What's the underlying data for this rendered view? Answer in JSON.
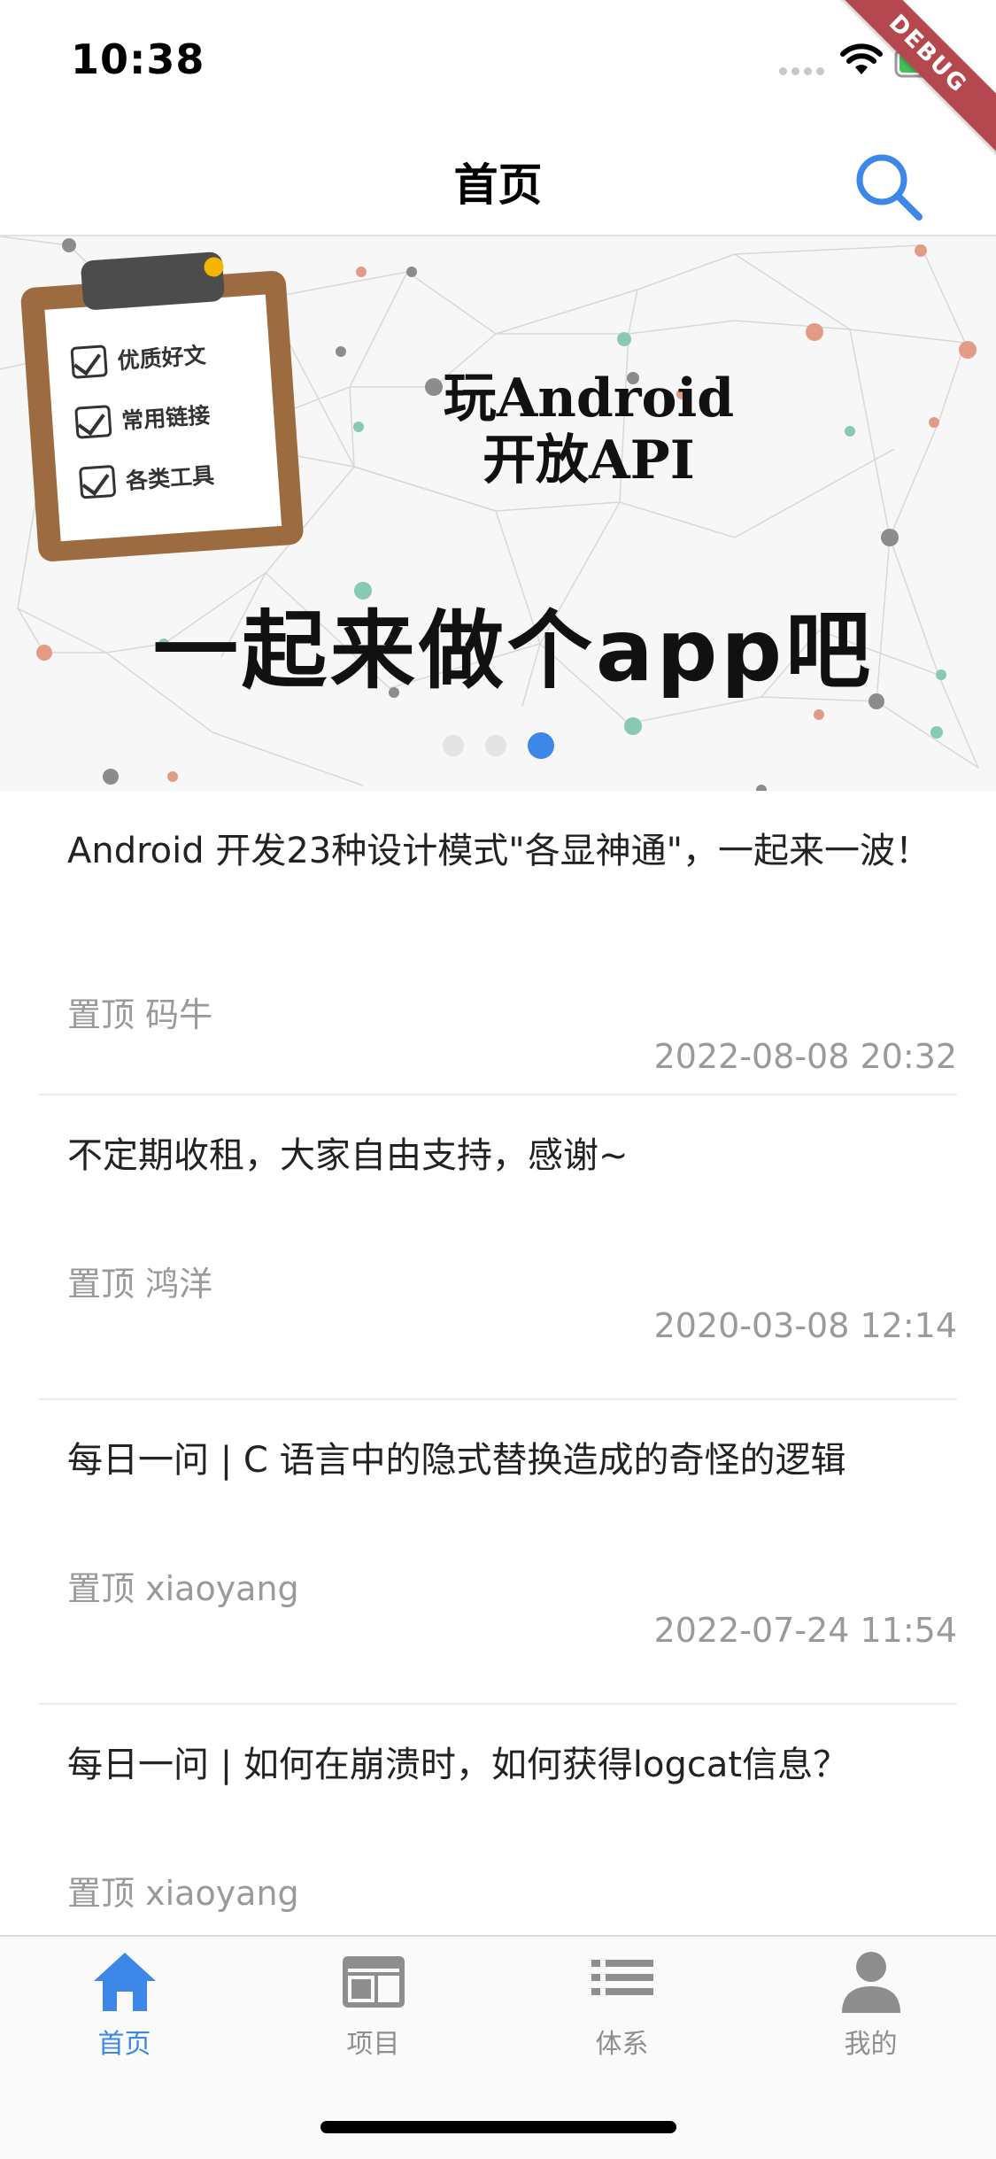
{
  "status_bar": {
    "time": "10:38",
    "debug_label": "DEBUG"
  },
  "app_bar": {
    "title": "首页",
    "search_icon": "search-icon"
  },
  "banner": {
    "clipboard_items": [
      "优质好文",
      "常用链接",
      "各类工具"
    ],
    "title_line1": "玩Android",
    "title_line2": "开放API",
    "slogan": "一起来做个app吧",
    "active_dot_index": 2,
    "dot_count": 3
  },
  "articles": [
    {
      "title": "Android 开发23种设计模式\"各显神通\"，一起来一波！",
      "tag": "置顶",
      "author": "码牛",
      "date": "2022-08-08 20:32"
    },
    {
      "title": "不定期收租，大家自由支持，感谢~",
      "tag": "置顶",
      "author": "鸿洋",
      "date": "2020-03-08 12:14"
    },
    {
      "title": "每日一问 | C 语言中的隐式替换造成的奇怪的逻辑",
      "tag": "置顶",
      "author": "xiaoyang",
      "date": "2022-07-24 11:54"
    },
    {
      "title": "每日一问 | 如何在崩溃时，如何获得logcat信息？",
      "tag": "置顶",
      "author": "xiaoyang",
      "date": ""
    }
  ],
  "bottom_nav": [
    {
      "label": "首页",
      "icon": "home-icon",
      "active": true
    },
    {
      "label": "项目",
      "icon": "project-icon",
      "active": false
    },
    {
      "label": "体系",
      "icon": "list-icon",
      "active": false
    },
    {
      "label": "我的",
      "icon": "person-icon",
      "active": false
    }
  ],
  "colors": {
    "accent": "#3d87e8",
    "meta_text": "#9a9a9a",
    "debug_banner": "#b5484e"
  }
}
